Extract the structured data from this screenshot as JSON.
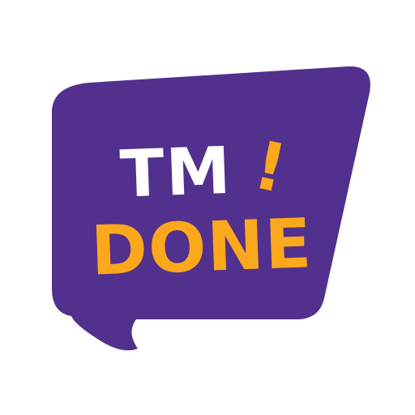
{
  "logo": {
    "line1": "TM",
    "exclamation": "!",
    "line2": "DONE"
  },
  "colors": {
    "bubble": "#52308D",
    "text_primary": "#FFFFFF",
    "accent": "#FBA81C",
    "background": "#FFFFFF"
  },
  "icon": "speech-bubble-logo"
}
